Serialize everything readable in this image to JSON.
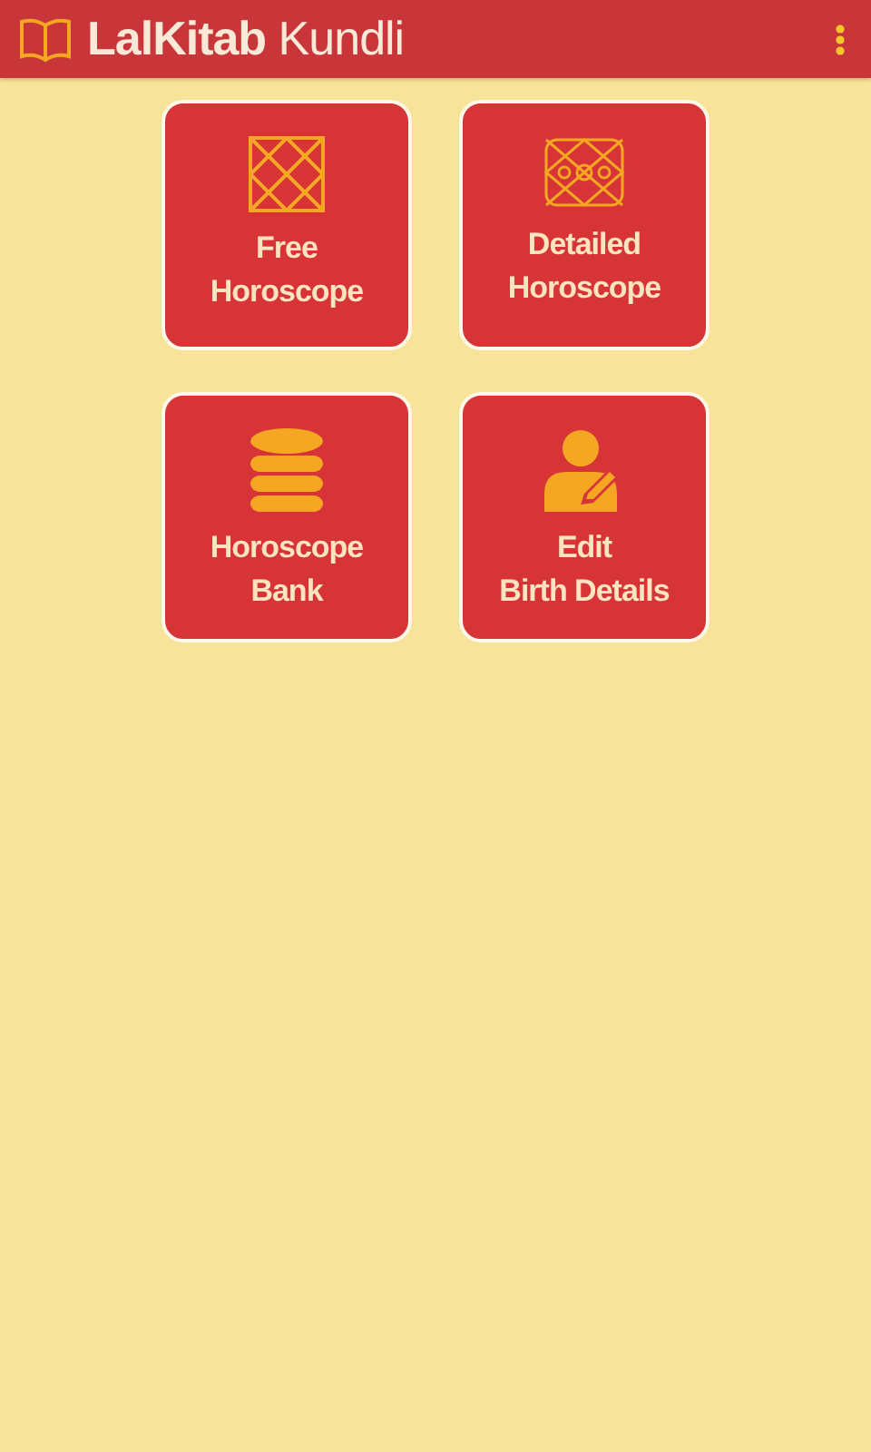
{
  "app_bar": {
    "title": "**LalKitab** Kundli"
  },
  "tiles": [
    {
      "kind": "chart",
      "lines": [
        "Free",
        "Horoscope"
      ]
    },
    {
      "kind": "detailed-chart",
      "lines": [
        "Detailed",
        "Horoscope"
      ]
    },
    {
      "kind": "database",
      "lines": [
        "Horoscope",
        "Bank"
      ]
    },
    {
      "kind": "user-edit",
      "lines": [
        "Edit",
        "Birth Details"
      ]
    }
  ]
}
